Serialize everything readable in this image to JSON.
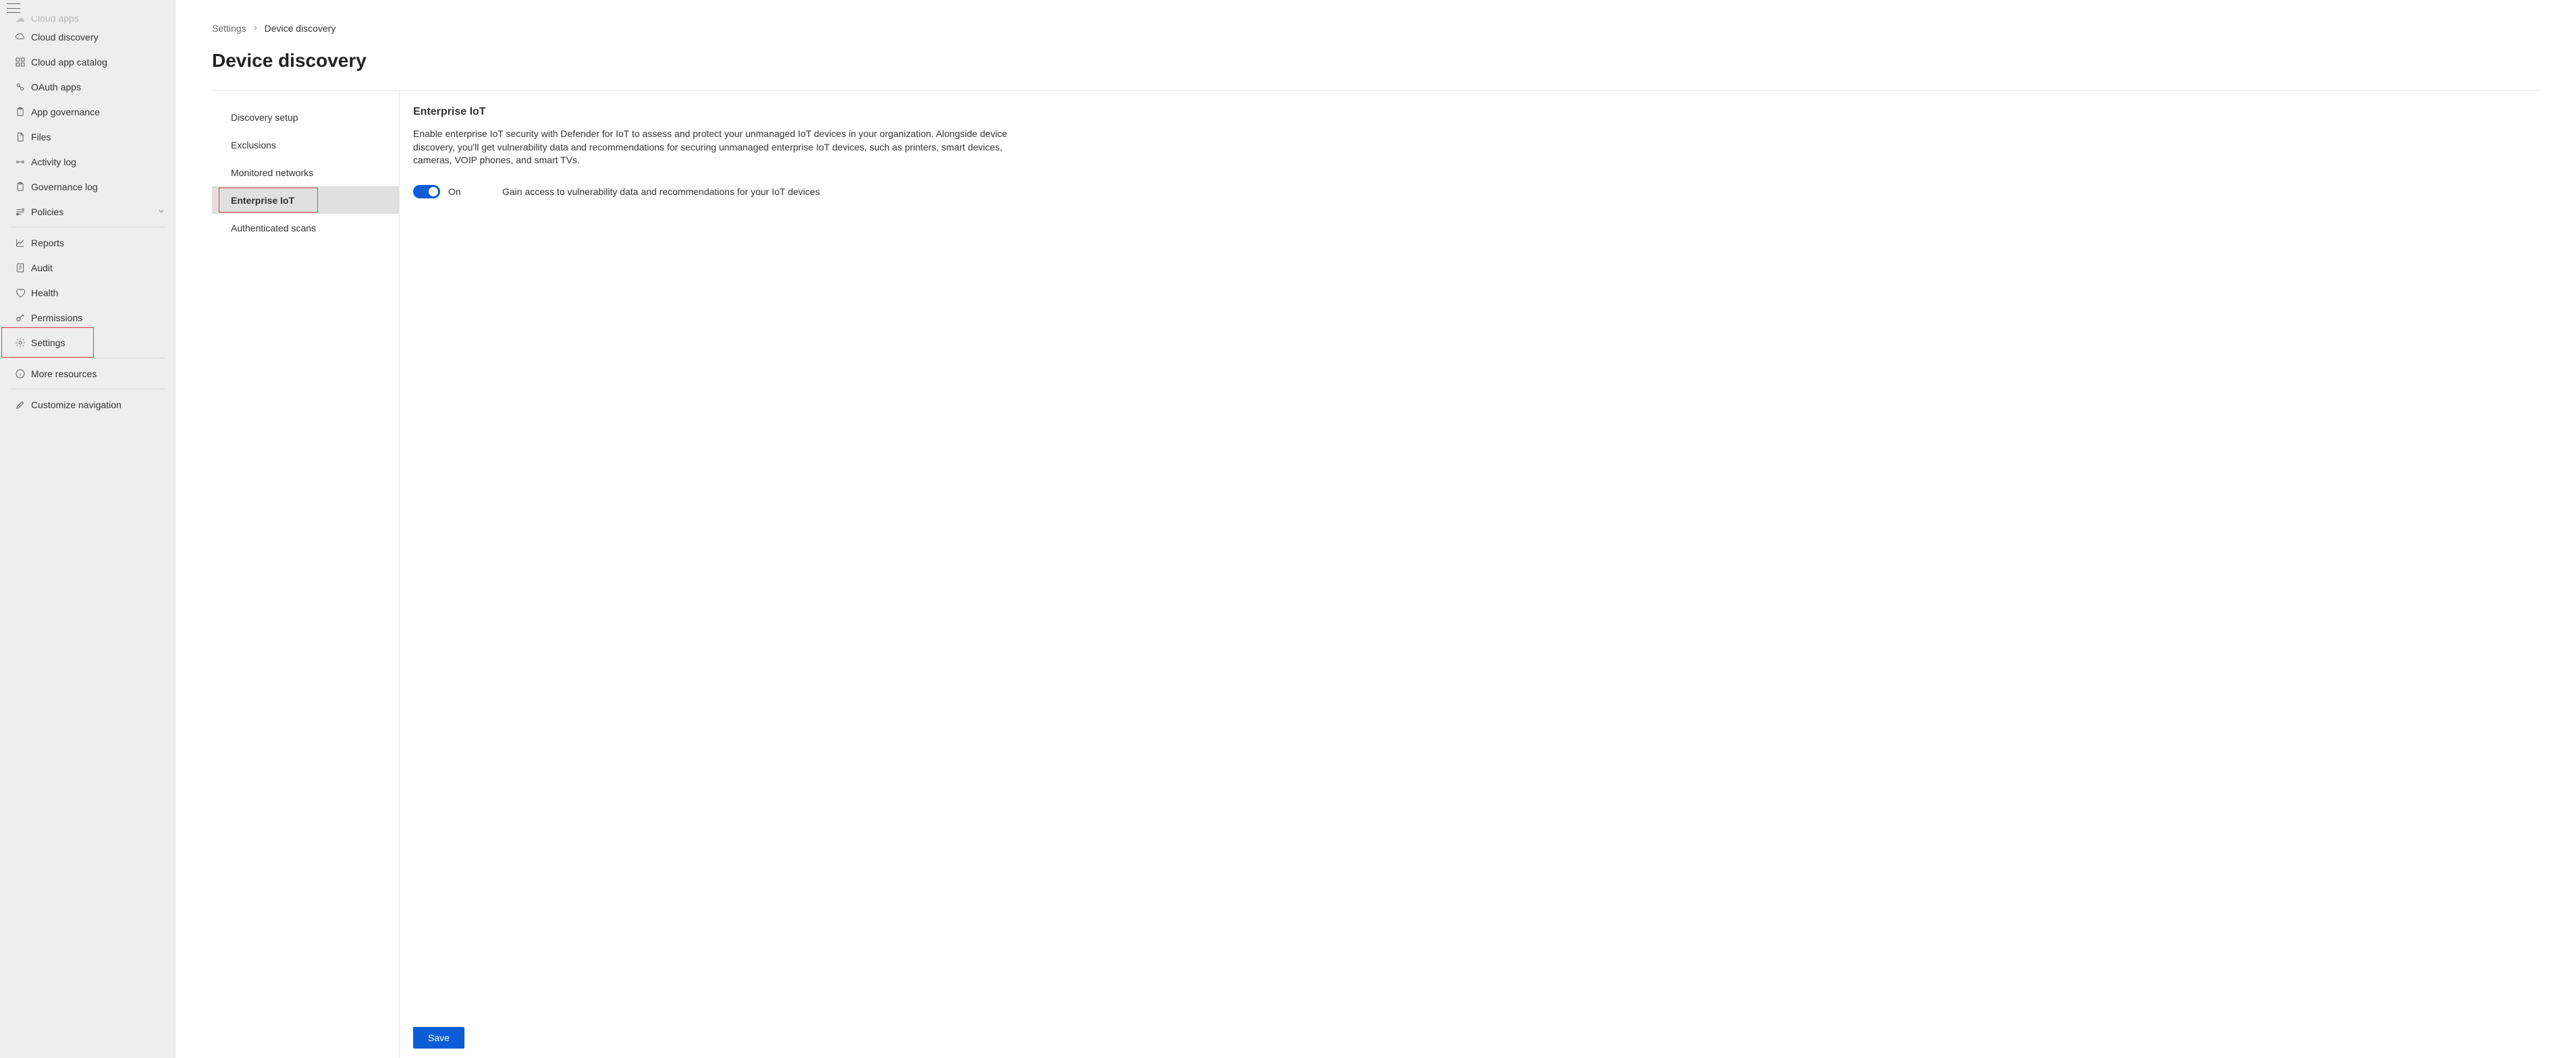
{
  "sidebar": {
    "items": [
      {
        "label": "Cloud apps",
        "icon": "cloud"
      },
      {
        "label": "Cloud discovery",
        "icon": "cloud-discovery"
      },
      {
        "label": "Cloud app catalog",
        "icon": "catalog"
      },
      {
        "label": "OAuth apps",
        "icon": "oauth"
      },
      {
        "label": "App governance",
        "icon": "clipboard"
      },
      {
        "label": "Files",
        "icon": "file"
      },
      {
        "label": "Activity log",
        "icon": "activity"
      },
      {
        "label": "Governance log",
        "icon": "clipboard"
      },
      {
        "label": "Policies",
        "icon": "policies",
        "expandable": true
      }
    ],
    "section2": [
      {
        "label": "Reports",
        "icon": "chart"
      },
      {
        "label": "Audit",
        "icon": "audit"
      },
      {
        "label": "Health",
        "icon": "health"
      },
      {
        "label": "Permissions",
        "icon": "key"
      },
      {
        "label": "Settings",
        "icon": "gear",
        "highlighted": true
      }
    ],
    "section3": [
      {
        "label": "More resources",
        "icon": "info"
      }
    ],
    "section4": [
      {
        "label": "Customize navigation",
        "icon": "pencil"
      }
    ]
  },
  "breadcrumb": {
    "root": "Settings",
    "leaf": "Device discovery"
  },
  "page_title": "Device discovery",
  "subnav": [
    {
      "label": "Discovery setup"
    },
    {
      "label": "Exclusions"
    },
    {
      "label": "Monitored networks"
    },
    {
      "label": "Enterprise IoT",
      "active": true,
      "highlighted": true
    },
    {
      "label": "Authenticated scans"
    }
  ],
  "panel": {
    "heading": "Enterprise IoT",
    "description": "Enable enterprise IoT security with Defender for IoT to assess and protect your unmanaged IoT devices in your organization. Alongside device discovery, you'll get vulnerability data and recommendations for securing unmanaged enterprise IoT devices, such as printers, smart devices, cameras, VOIP phones, and smart TVs.",
    "toggle_state": "On",
    "toggle_description": "Gain access to vulnerability data and recommendations for your IoT devices",
    "save_label": "Save"
  }
}
